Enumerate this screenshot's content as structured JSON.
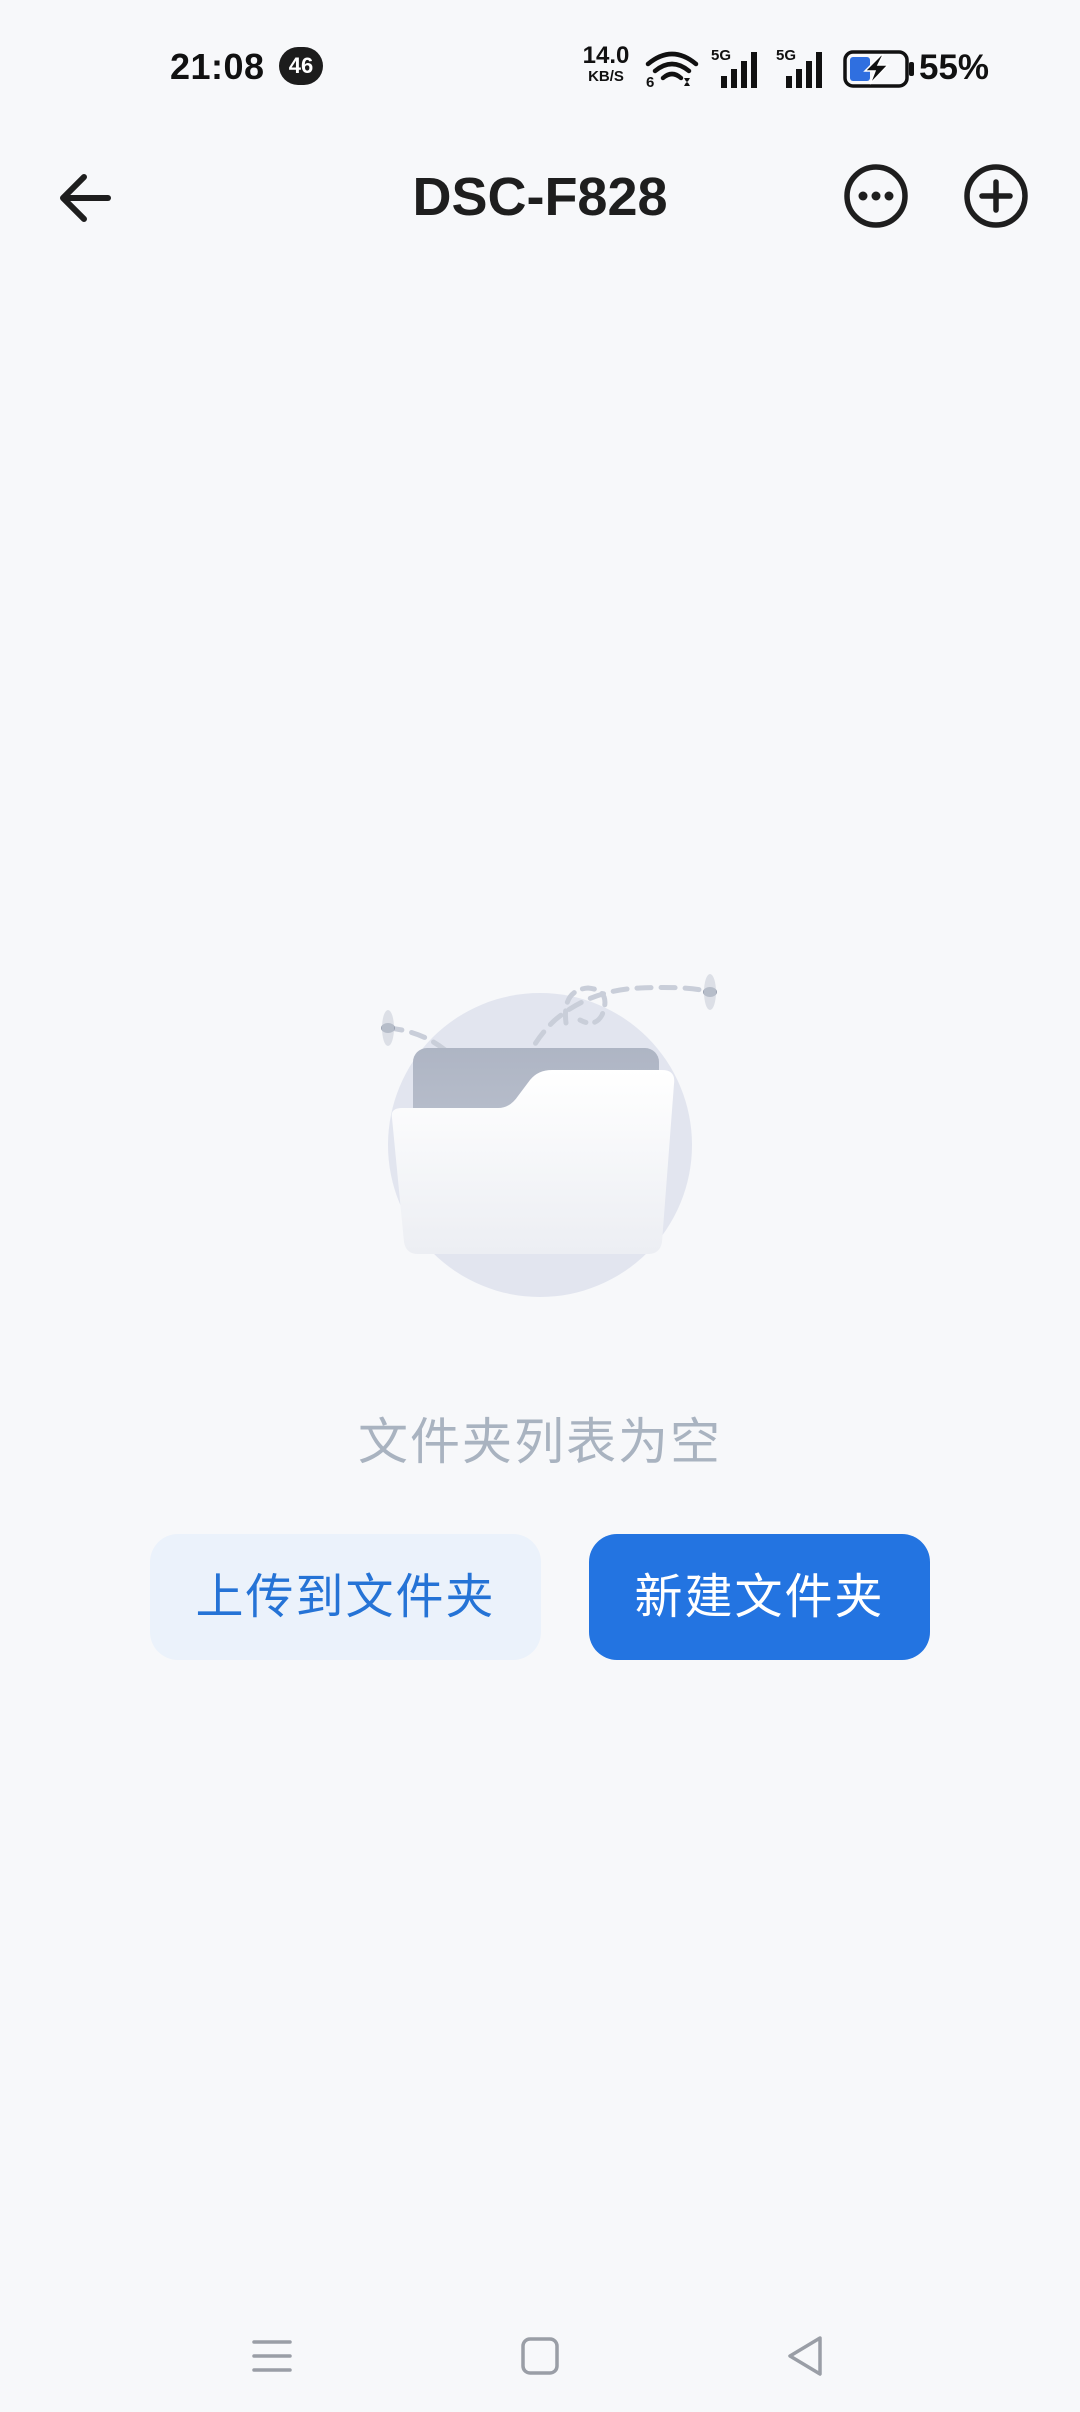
{
  "status_bar": {
    "time": "21:08",
    "notification_count": "46",
    "net_speed_value": "14.0",
    "net_speed_unit": "KB/S",
    "wifi_sub_label": "6",
    "signal_1_label": "5G",
    "signal_2_label": "5G",
    "battery_percent": "55%",
    "icons": [
      "wifi-icon",
      "signal-5g-icon",
      "signal-5g-icon",
      "battery-charging-icon"
    ]
  },
  "header": {
    "title": "DSC-F828",
    "back_icon": "arrow-left-icon",
    "more_icon": "more-horizontal-circle-icon",
    "add_icon": "plus-circle-icon"
  },
  "empty_state": {
    "message": "文件夹列表为空",
    "illustration_icon": "empty-folder-icon"
  },
  "actions": {
    "upload_label": "上传到文件夹",
    "new_folder_label": "新建文件夹"
  },
  "nav_bar": {
    "icons": [
      "menu-icon",
      "home-square-icon",
      "back-triangle-icon"
    ]
  },
  "colors": {
    "background": "#f7f8fa",
    "primary": "#2374e1",
    "secondary_button_bg": "#ebf2fb",
    "secondary_button_text": "#2573d6",
    "empty_text": "#a9b3c0"
  }
}
